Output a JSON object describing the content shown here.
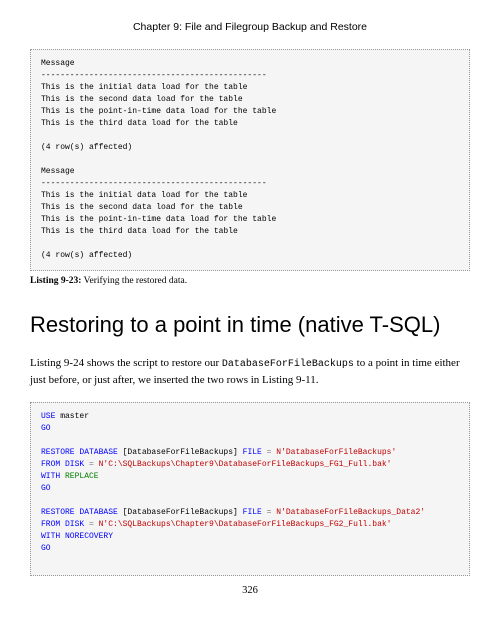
{
  "chapter_header": "Chapter 9: File and Filegroup Backup and Restore",
  "code_block_1": {
    "lines": [
      "Message",
      "-----------------------------------------------",
      "This is the initial data load for the table",
      "This is the second data load for the table",
      "This is the point-in-time data load for the table",
      "This is the third data load for the table",
      "",
      "(4 row(s) affected)",
      "",
      "Message",
      "-----------------------------------------------",
      "This is the initial data load for the table",
      "This is the second data load for the table",
      "This is the point-in-time data load for the table",
      "This is the third data load for the table",
      "",
      "(4 row(s) affected)"
    ]
  },
  "listing_923_label": "Listing 9-23:",
  "listing_923_text": " Verifying the restored data.",
  "section_heading": "Restoring to a point in time (native T-SQL)",
  "body_para_prefix": "Listing 9-24 shows the script to restore our ",
  "body_para_mono": "DatabaseForFileBackups",
  "body_para_suffix": " to a point in time either just before, or just after, we inserted the two rows in Listing 9-11.",
  "sql": {
    "use": "USE",
    "master": " master",
    "go": "GO",
    "restore_database": "RESTORE DATABASE",
    "db_bracket": " [DatabaseForFileBackups] ",
    "file_kw": "FILE",
    "eq": " = ",
    "str1": "N'DatabaseForFileBackups'",
    "from_disk": "FROM DISK",
    "path1": "N'C:\\SQLBackups\\Chapter9\\DatabaseForFileBackups_FG1_Full.bak'",
    "with": "WITH",
    "replace": " REPLACE",
    "str2": "N'DatabaseForFileBackups_Data2'",
    "path2": "N'C:\\SQLBackups\\Chapter9\\DatabaseForFileBackups_FG2_Full.bak'",
    "norecovery": " NORECOVERY"
  },
  "page_number": "326"
}
